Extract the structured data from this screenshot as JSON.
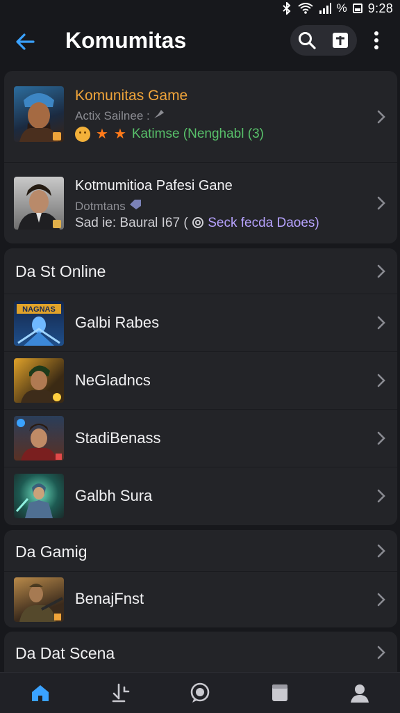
{
  "status_bar": {
    "time": "9:28",
    "battery_text": "%"
  },
  "header": {
    "title": "Komumitas"
  },
  "featured": [
    {
      "title": "Komunitas Game",
      "subtitle": "Actix Sailnee :",
      "rating_text": "Katimse (Nenghabl (3)"
    },
    {
      "title": "Kotmumitioa Pafesi Gane",
      "subtitle": "Dotmtans",
      "meta_left": "Sad ie: Baural I67 (",
      "meta_right": "Seck fecda Daoes)"
    }
  ],
  "section_online": {
    "header": "Da St Online",
    "items": [
      {
        "label": "Galbi Rabes",
        "thumb_text": "NAGNAS"
      },
      {
        "label": "NeGladncs"
      },
      {
        "label": "StadiBenass"
      },
      {
        "label": "Galbh Sura"
      }
    ]
  },
  "section_gaming": {
    "header": "Da Gamig",
    "items": [
      {
        "label": "BenajFnst"
      }
    ]
  },
  "section_dat": {
    "header": "Da Dat Scena"
  },
  "colors": {
    "accent": "#3aa2ff",
    "title_orange": "#f0a43a",
    "green": "#58c06a",
    "purple": "#b7a3ff"
  },
  "icons": [
    "back-arrow-icon",
    "search-icon",
    "add-icon",
    "more-vert-icon",
    "home-icon",
    "download-icon",
    "chat-icon",
    "library-icon",
    "profile-icon"
  ]
}
